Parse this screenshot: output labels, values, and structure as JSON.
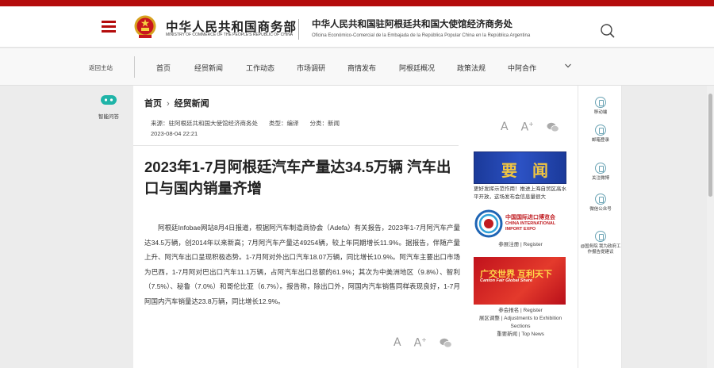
{
  "header": {
    "brand_cn": "中华人民共和国商务部",
    "brand_en": "MINISTRY OF COMMERCE OF THE PEOPLE'S REPUBLIC OF CHINA",
    "office_cn": "中华人民共和国驻阿根廷共和国大使馆经济商务处",
    "office_es": "Oficina Económico-Comercial de la Embajada de la República Popular China en la República Argentina"
  },
  "nav": {
    "home": "返回主站",
    "items": [
      "首页",
      "经贸新闻",
      "工作动态",
      "市场调研",
      "商情发布",
      "阿根廷概况",
      "政策法规",
      "中阿合作"
    ]
  },
  "left_rail": {
    "label": "智能问答"
  },
  "article": {
    "breadcrumb": [
      "首页",
      "经贸新闻"
    ],
    "source": "来源：驻阿根廷共和国大使馆经济商务处",
    "type": "类型：编译",
    "category": "分类：新闻",
    "date": "2023-08-04 22:21",
    "title": "2023年1-7月阿根廷汽车产量达34.5万辆 汽车出口与国内销量齐增",
    "body": "阿根廷Infobae网站8月4日报道，根据阿汽车制造商协会（Adefa）有关报告，2023年1-7月阿汽车产量达34.5万辆，创2014年以来新高；7月阿汽车产量达49254辆，较上年同期增长11.9%。据报告，伴随产量上升、阿汽车出口呈现积极态势。1-7月阿对外出口汽车18.07万辆，同比增长10.9%。阿汽车主要出口市场为巴西，1-7月阿对巴出口汽车11.1万辆，占阿汽车出口总额的61.9%；其次为中美洲地区（9.8%）、智利（7.5%）、秘鲁（7.0%）和哥伦比亚（6.7%）。报告称，除出口外，阿国内汽车销售同样表现良好，1-7月阿国内汽车销量达23.8万辆，同比增长12.9%。"
  },
  "sidebar": {
    "banner1": "要 闻",
    "banner1_caption": "更好发挥示范作用！推进上海自贸区高水平开放，这场发布会信息量很大",
    "ciie_cn": "中国国际进口博览会",
    "ciie_en_1": "CHINA INTERNATIONAL",
    "ciie_en_2": "IMPORT EXPO",
    "ciie_links": "参展注册 | Register",
    "canton_cn": "广交世界 互利天下",
    "canton_en": "Canton Fair   Global Share",
    "canton_links_1": "参会报名 | Register",
    "canton_links_2": "展区调整 | Adjustments to Exhibition Sections",
    "canton_links_3": "重要新闻 | Top News"
  },
  "right_rail": {
    "items": [
      "移动端",
      "邮箱登录",
      "关注微博",
      "微信公众号",
      "@国务院 我为政府工作报告提建议"
    ]
  },
  "colors": {
    "brand_red": "#b40c0c",
    "accent_teal": "#6aa3b4"
  }
}
